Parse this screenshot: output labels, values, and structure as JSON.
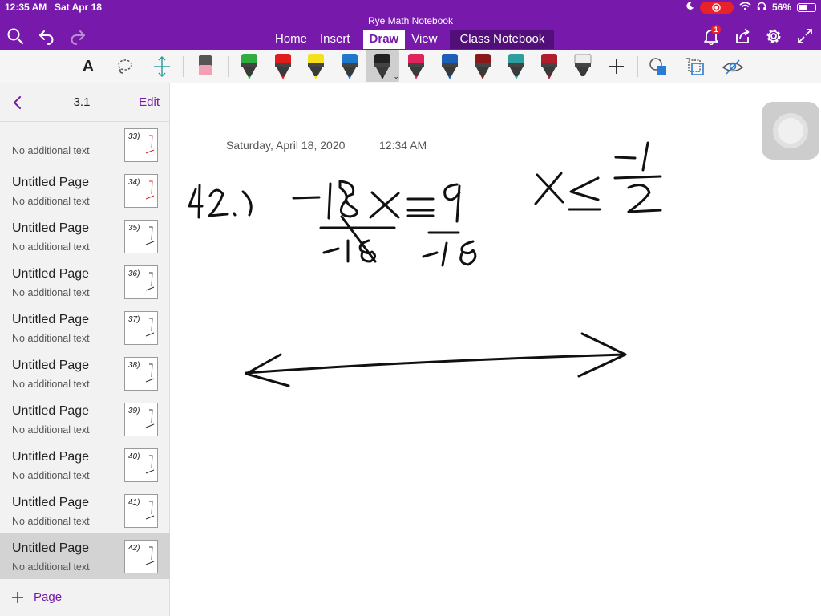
{
  "status_bar": {
    "time": "12:35 AM",
    "date": "Sat Apr 18",
    "battery": "56%",
    "battery_level": 0.56
  },
  "header": {
    "notebook_title": "Rye Math Notebook",
    "tabs": [
      {
        "label": "Home"
      },
      {
        "label": "Insert"
      },
      {
        "label": "Draw"
      },
      {
        "label": "View"
      },
      {
        "label": "Class Notebook"
      }
    ],
    "active_tab": "Draw",
    "notification_count": "1"
  },
  "toolbar": {
    "text_tool_label": "A",
    "pen_colors": [
      "#2fae3f",
      "#e01b1b",
      "#f5e11b",
      "#1f77c9",
      "#222222",
      "#e0245e",
      "#1d5fb8",
      "#8a1a1a",
      "#2e9e9e",
      "#b01e2e",
      "#eeeeee"
    ]
  },
  "sidebar": {
    "section": "3.1",
    "edit_label": "Edit",
    "pages": [
      {
        "title": "",
        "subtitle": "No additional text",
        "thumb": "33)"
      },
      {
        "title": "Untitled Page",
        "subtitle": "No additional text",
        "thumb": "34)"
      },
      {
        "title": "Untitled Page",
        "subtitle": "No additional text",
        "thumb": "35)"
      },
      {
        "title": "Untitled Page",
        "subtitle": "No additional text",
        "thumb": "36)"
      },
      {
        "title": "Untitled Page",
        "subtitle": "No additional text",
        "thumb": "37)"
      },
      {
        "title": "Untitled Page",
        "subtitle": "No additional text",
        "thumb": "38)"
      },
      {
        "title": "Untitled Page",
        "subtitle": "No additional text",
        "thumb": "39)"
      },
      {
        "title": "Untitled Page",
        "subtitle": "No additional text",
        "thumb": "40)"
      },
      {
        "title": "Untitled Page",
        "subtitle": "No additional text",
        "thumb": "41)"
      },
      {
        "title": "Untitled Page",
        "subtitle": "No additional text",
        "thumb": "42)"
      }
    ],
    "selected_index": 9,
    "add_page_label": "Page"
  },
  "page": {
    "date": "Saturday, April 18, 2020",
    "time": "12:34 AM"
  }
}
